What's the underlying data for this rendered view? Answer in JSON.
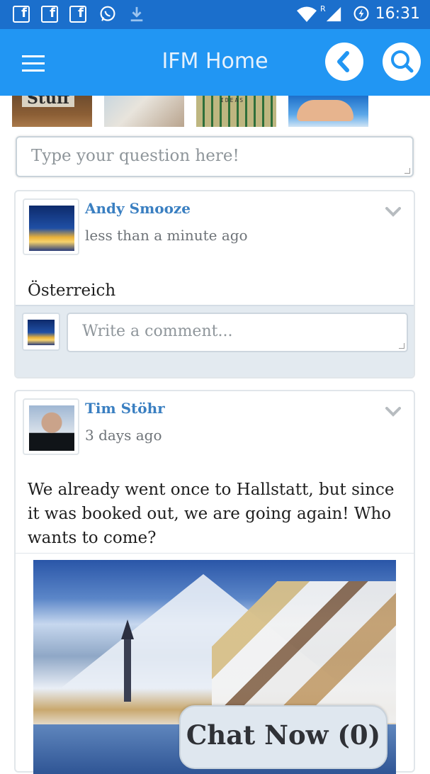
{
  "statusbar": {
    "icons": [
      "facebook-icon",
      "facebook-icon",
      "facebook-icon",
      "whatsapp-icon",
      "download-icon",
      "wifi-icon",
      "signal-icon",
      "battery-charging-icon"
    ],
    "roaming": "R",
    "time": "16:31"
  },
  "appbar": {
    "title": "IFM Home",
    "color": "#2196f3"
  },
  "thumbnails": {
    "first_label": "Stuff",
    "second_label": "IDEAS"
  },
  "question": {
    "placeholder": "Type your question here!"
  },
  "posts": [
    {
      "author": "Andy Smooze",
      "time": "less than a minute ago",
      "text": "Österreich",
      "comment_placeholder": "Write a comment..."
    },
    {
      "author": "Tim Stöhr",
      "time": "3 days ago",
      "text": "We already went once to Hallstatt, but since it was booked out, we are going again! Who wants to come?"
    }
  ],
  "chat": {
    "label": "Chat Now (0)"
  }
}
